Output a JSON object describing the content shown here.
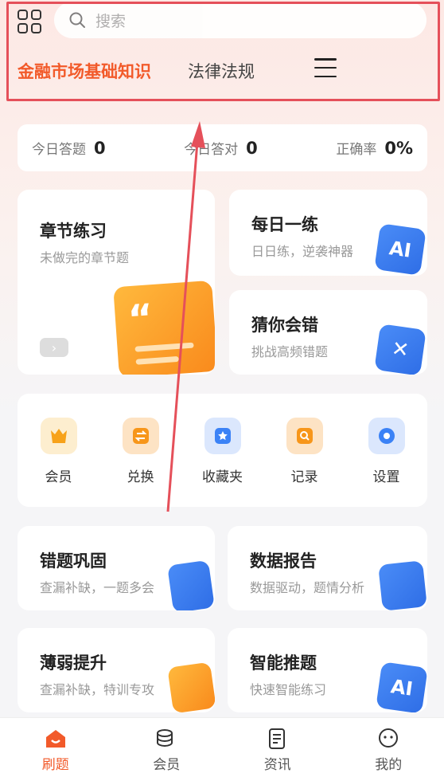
{
  "search": {
    "placeholder": "搜索"
  },
  "tabs": [
    {
      "label": "金融市场基础知识",
      "active": true
    },
    {
      "label": "法律法规",
      "active": false
    }
  ],
  "stats": [
    {
      "label": "今日答题",
      "value": "0"
    },
    {
      "label": "今日答对",
      "value": "0"
    },
    {
      "label": "正确率",
      "value": "0%"
    }
  ],
  "cards": {
    "chapter": {
      "title": "章节练习",
      "subtitle": "未做完的章节题"
    },
    "daily": {
      "title": "每日一练",
      "subtitle": "日日练，逆袭神器"
    },
    "guess": {
      "title": "猜你会错",
      "subtitle": "挑战高频错题"
    },
    "mistakes": {
      "title": "错题巩固",
      "subtitle": "查漏补缺，一题多会"
    },
    "report": {
      "title": "数据报告",
      "subtitle": "数据驱动，题情分析"
    },
    "weak": {
      "title": "薄弱提升",
      "subtitle": "查漏补缺，特训专攻"
    },
    "smart": {
      "title": "智能推题",
      "subtitle": "快速智能练习"
    }
  },
  "shortcuts": [
    {
      "label": "会员",
      "icon": "crown-icon",
      "color": "#f7a21a"
    },
    {
      "label": "兑换",
      "icon": "exchange-icon",
      "color": "#f7961a"
    },
    {
      "label": "收藏夹",
      "icon": "star-folder-icon",
      "color": "#3b82f6"
    },
    {
      "label": "记录",
      "icon": "record-search-icon",
      "color": "#f7961a"
    },
    {
      "label": "设置",
      "icon": "gear-icon",
      "color": "#3b82f6"
    }
  ],
  "nav": [
    {
      "label": "刷题",
      "active": true
    },
    {
      "label": "会员",
      "active": false
    },
    {
      "label": "资讯",
      "active": false
    },
    {
      "label": "我的",
      "active": false
    }
  ],
  "colors": {
    "accent": "#f25a2a",
    "annotation": "#e5505a"
  }
}
